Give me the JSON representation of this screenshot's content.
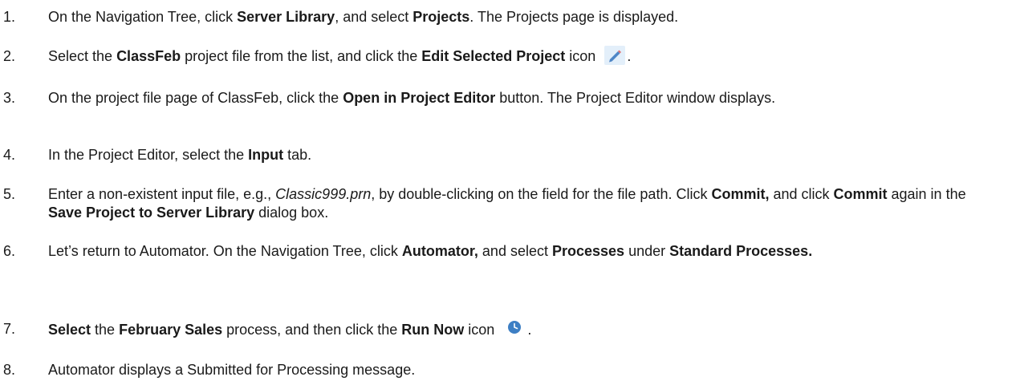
{
  "steps": [
    {
      "num": "1.",
      "parts": [
        {
          "t": "On the Navigation Tree, click "
        },
        {
          "t": "Server Library",
          "b": true
        },
        {
          "t": ", and select "
        },
        {
          "t": "Projects",
          "b": true
        },
        {
          "t": ". The Projects page is displayed."
        }
      ]
    },
    {
      "num": "2.",
      "parts": [
        {
          "t": "Select the "
        },
        {
          "t": "ClassFeb",
          "b": true
        },
        {
          "t": " project file from the list, and click the "
        },
        {
          "t": "Edit Selected Project",
          "b": true
        },
        {
          "t": " icon "
        },
        {
          "icon": "pencil-icon"
        },
        {
          "t": "."
        }
      ]
    },
    {
      "num": "3.",
      "parts": [
        {
          "t": "On the project file page of ClassFeb, click the "
        },
        {
          "t": "Open in Project Editor",
          "b": true
        },
        {
          "t": " button. The Project Editor window displays."
        }
      ]
    },
    {
      "num": "4.",
      "parts": [
        {
          "t": "In the Project Editor, select the "
        },
        {
          "t": "Input",
          "b": true
        },
        {
          "t": " tab."
        }
      ]
    },
    {
      "num": "5.",
      "parts": [
        {
          "t": "Enter a non-existent input file, e.g., "
        },
        {
          "t": "Classic999.prn",
          "i": true
        },
        {
          "t": ", by double-clicking on the field for the file path. Click "
        },
        {
          "t": "Commit,",
          "b": true
        },
        {
          "t": " and click "
        },
        {
          "t": "Commit",
          "b": true
        },
        {
          "t": " again in the "
        },
        {
          "t": "Save Project to Server Library",
          "b": true
        },
        {
          "t": " dialog box."
        }
      ]
    },
    {
      "num": "6.",
      "parts": [
        {
          "t": "Let’s return to Automator. On the Navigation Tree, click "
        },
        {
          "t": "Automator,",
          "b": true
        },
        {
          "t": " and select "
        },
        {
          "t": "Processes",
          "b": true
        },
        {
          "t": " under "
        },
        {
          "t": "Standard Processes.",
          "b": true
        }
      ]
    },
    {
      "num": "7.",
      "parts": [
        {
          "t": "Select",
          "b": true
        },
        {
          "t": " the "
        },
        {
          "t": "February Sales",
          "b": true
        },
        {
          "t": " process, and then click the "
        },
        {
          "t": "Run Now",
          "b": true
        },
        {
          "t": " icon "
        },
        {
          "icon": "clock-icon"
        },
        {
          "t": "."
        }
      ]
    },
    {
      "num": "8.",
      "parts": [
        {
          "t": "Automator displays a Submitted for Processing message."
        }
      ]
    }
  ]
}
